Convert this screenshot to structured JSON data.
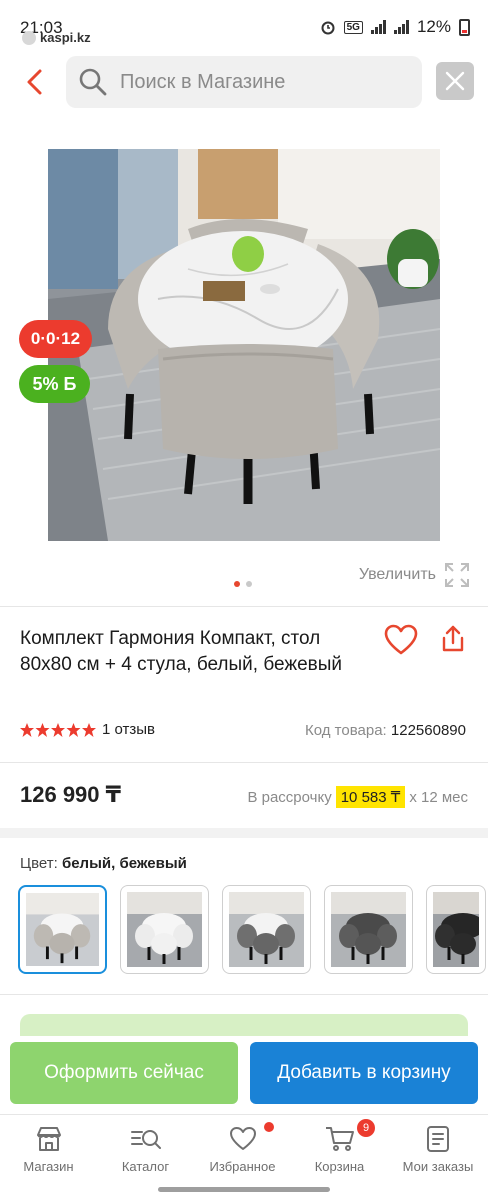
{
  "status_bar": {
    "time": "21:03",
    "source_app": "kaspi.kz",
    "network": "5G",
    "battery": "12%"
  },
  "header": {
    "search_placeholder": "Поиск в Магазине"
  },
  "gallery": {
    "loan_badge": "0·0·12",
    "bonus_badge": "5% Б",
    "zoom_label": "Увеличить",
    "image_count": 2,
    "active_image": 1
  },
  "product": {
    "title": "Комплект Гармония Компакт, стол 80x80 см + 4 стула, белый, бежевый",
    "rating_stars": 5,
    "reviews": "1 отзыв",
    "code_label": "Код товара:",
    "code_value": "122560890",
    "price": "126 990 ₸",
    "installment_label": "В рассрочку",
    "installment_amount": "10 583 ₸",
    "installment_term": "x 12 мес"
  },
  "color": {
    "label": "Цвет:",
    "value": "белый, бежевый",
    "variant_count": 5,
    "selected_variant": 1
  },
  "actions": {
    "buy_now": "Оформить сейчас",
    "add_to_cart": "Добавить в корзину"
  },
  "tabbar": {
    "items": [
      {
        "label": "Магазин",
        "icon": "store-icon"
      },
      {
        "label": "Каталог",
        "icon": "catalog-search-icon"
      },
      {
        "label": "Избранное",
        "icon": "heart-icon"
      },
      {
        "label": "Корзина",
        "icon": "cart-icon",
        "badge": "9"
      },
      {
        "label": "Мои заказы",
        "icon": "orders-icon"
      }
    ]
  },
  "colors": {
    "accent_red": "#ec3b2e",
    "green_button": "#8ed46e",
    "blue_button": "#1a82d6",
    "installment_highlight": "#ffe400",
    "selected_border": "#1a8fdc"
  }
}
